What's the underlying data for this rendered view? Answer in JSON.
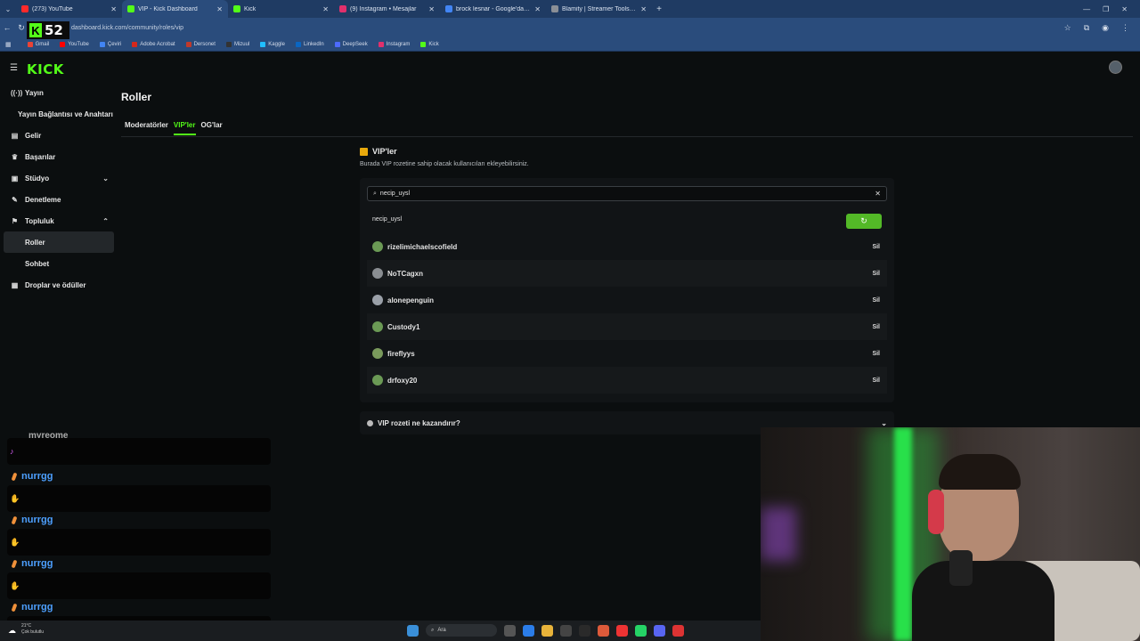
{
  "browser": {
    "tabs": [
      {
        "title": "(273) YouTube",
        "color": "#ff2a2a",
        "active": false
      },
      {
        "title": "VIP - Kick Dashboard",
        "color": "#53fc18",
        "active": true
      },
      {
        "title": "Kick",
        "color": "#53fc18",
        "active": false
      },
      {
        "title": "(9) Instagram • Mesajlar",
        "color": "#e1306c",
        "active": false
      },
      {
        "title": "brock lesnar - Google'da Ara",
        "color": "#4285f4",
        "active": false
      },
      {
        "title": "Blamity | Streamer Tools & Part...",
        "color": "#8a8f96",
        "active": false
      }
    ],
    "url": "dashboard.kick.com/community/roles/vip",
    "bookmarks": [
      {
        "label": "Gmail",
        "color": "#ea4335"
      },
      {
        "label": "YouTube",
        "color": "#ff0000"
      },
      {
        "label": "Çeviri",
        "color": "#4285f4"
      },
      {
        "label": "Adobe Acrobat",
        "color": "#d4281c"
      },
      {
        "label": "Dersonet",
        "color": "#c0392b"
      },
      {
        "label": "Mizuul",
        "color": "#333333"
      },
      {
        "label": "Kaggle",
        "color": "#20beff"
      },
      {
        "label": "LinkedIn",
        "color": "#0a66c2"
      },
      {
        "label": "DeepSeek",
        "color": "#4d6bfe"
      },
      {
        "label": "Instagram",
        "color": "#e1306c"
      },
      {
        "label": "Kick",
        "color": "#53fc18"
      }
    ],
    "badge_number": "52"
  },
  "app": {
    "logo": "KICK",
    "sidebar": {
      "items": [
        {
          "label": "Yayın",
          "icon": "broadcast-icon",
          "glyph": "((·))"
        },
        {
          "label": "Yayın Bağlantısı ve Anahtarı",
          "sub": true
        },
        {
          "label": "Gelir",
          "icon": "wallet-icon",
          "glyph": "▤"
        },
        {
          "label": "Başarılar",
          "icon": "trophy-icon",
          "glyph": "♛"
        },
        {
          "label": "Stüdyo",
          "icon": "studio-icon",
          "glyph": "▣",
          "chevron": "⌄"
        },
        {
          "label": "Denetleme",
          "icon": "wrench-icon",
          "glyph": "✎"
        },
        {
          "label": "Topluluk",
          "icon": "community-icon",
          "glyph": "⚑",
          "chevron": "⌃"
        },
        {
          "label": "Roller",
          "sub": true,
          "active": true
        },
        {
          "label": "Sohbet",
          "sub": true
        },
        {
          "label": "Droplar ve ödüller",
          "icon": "gift-icon",
          "glyph": "▦"
        }
      ]
    },
    "page_title": "Roller",
    "tabs": [
      "Moderatörler",
      "VIP'ler",
      "OG'lar"
    ],
    "active_tab": 1,
    "vip": {
      "title": "VIP'ler",
      "description": "Burada VIP rozetine sahip olacak kullanıcıları ekleyebilirsiniz.",
      "search_value": "necip_uysl",
      "search_result": "necip_uysl",
      "add_button_glyph": "↻",
      "delete_label": "Sil",
      "users": [
        {
          "name": "rizelimichaelscofield",
          "avatar_color": "#6b9a55"
        },
        {
          "name": "NoTCagxn",
          "avatar_color": "#8a8e92"
        },
        {
          "name": "alonepenguin",
          "avatar_color": "#9aa0a8"
        },
        {
          "name": "Custody1",
          "avatar_color": "#6b9a55"
        },
        {
          "name": "fireflyys",
          "avatar_color": "#7a9a5c"
        },
        {
          "name": "drfoxy20",
          "avatar_color": "#6b9a55"
        }
      ]
    },
    "faq": {
      "label": "VIP rozeti ne kazandırır?"
    }
  },
  "chat": {
    "top_partial_name": "myreome",
    "messages": [
      {
        "name": "nurrgg"
      },
      {
        "name": "nurrgg"
      },
      {
        "name": "nurrgg"
      },
      {
        "name": "nurrgg"
      }
    ]
  },
  "taskbar": {
    "weather_temp": "21°C",
    "weather_desc": "Çok bulutlu",
    "search_label": "Ara"
  }
}
